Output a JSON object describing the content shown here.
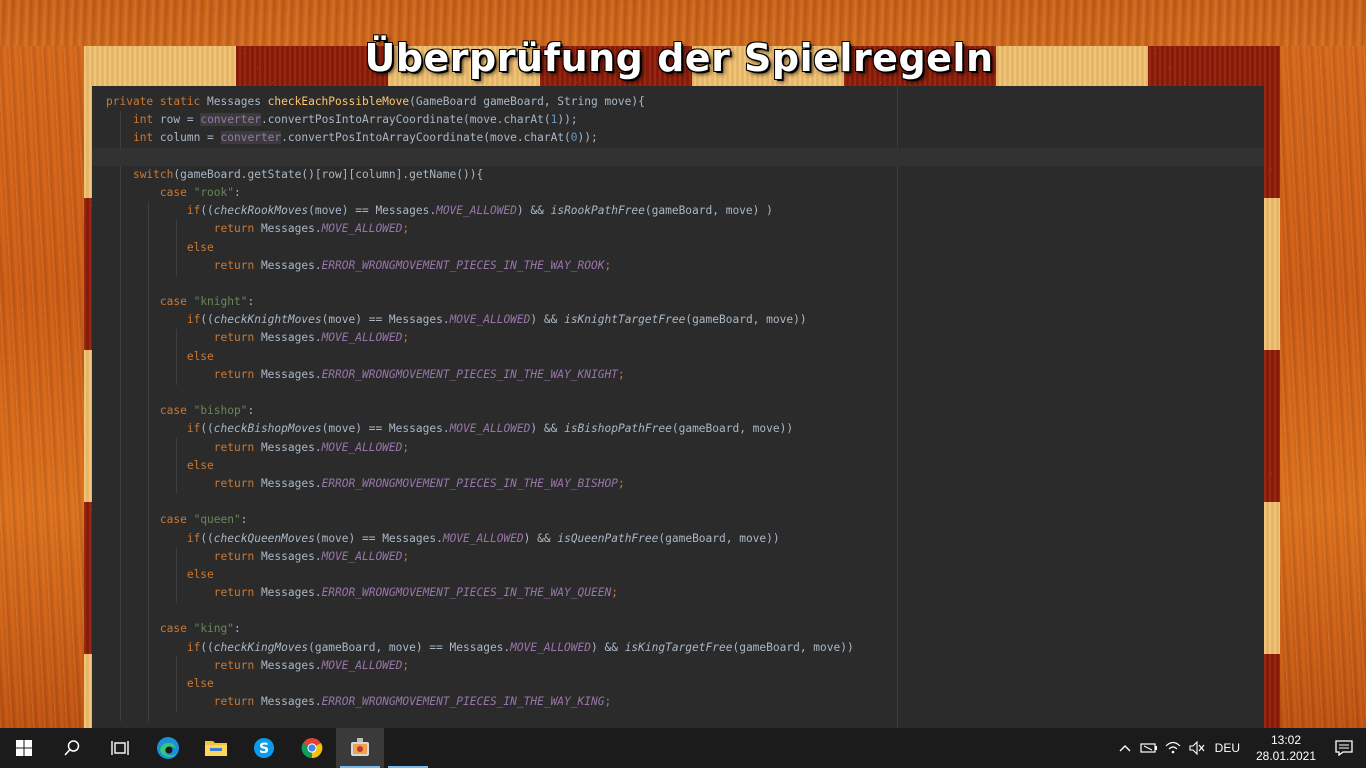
{
  "slide": {
    "title": "Überprüfung der Spielregeln"
  },
  "code": {
    "lines": [
      [
        [
          "kw",
          "private static "
        ],
        [
          "",
          "Messages "
        ],
        [
          "fn",
          "checkEachPossibleMove"
        ],
        [
          "",
          "(GameBoard gameBoard, String move){"
        ]
      ],
      [
        [
          "",
          "    "
        ],
        [
          "kw",
          "int "
        ],
        [
          "",
          "row = "
        ],
        [
          "fld",
          "converter"
        ],
        [
          "",
          ".convertPosIntoArrayCoordinate"
        ],
        [
          "",
          "(move.charAt("
        ],
        [
          "num",
          "1"
        ],
        [
          "",
          "));"
        ]
      ],
      [
        [
          "",
          "    "
        ],
        [
          "kw",
          "int "
        ],
        [
          "",
          "column = "
        ],
        [
          "fld",
          "converter"
        ],
        [
          "",
          ".convertPosIntoArrayCoordinate"
        ],
        [
          "",
          "(move.charAt("
        ],
        [
          "num",
          "0"
        ],
        [
          "",
          "));"
        ]
      ],
      [
        [
          "",
          ""
        ]
      ],
      [
        [
          "",
          "    "
        ],
        [
          "kw",
          "switch"
        ],
        [
          "",
          "(gameBoard.getState()[row][column].getName()){"
        ]
      ],
      [
        [
          "",
          "        "
        ],
        [
          "kw",
          "case "
        ],
        [
          "str",
          "\"rook\""
        ],
        [
          "",
          ":"
        ]
      ],
      [
        [
          "",
          "            "
        ],
        [
          "kw",
          "if"
        ],
        [
          "",
          "(("
        ],
        [
          "itl",
          "checkRookMoves"
        ],
        [
          "",
          "(move) == Messages."
        ],
        [
          "cst",
          "MOVE_ALLOWED"
        ],
        [
          "",
          ") && "
        ],
        [
          "itl",
          "isRookPathFree"
        ],
        [
          "",
          "(gameBoard, move) )"
        ]
      ],
      [
        [
          "",
          "                "
        ],
        [
          "kw",
          "return "
        ],
        [
          "",
          "Messages."
        ],
        [
          "cst",
          "MOVE_ALLOWED"
        ],
        [
          "kw",
          ";"
        ]
      ],
      [
        [
          "",
          "            "
        ],
        [
          "kw",
          "else"
        ]
      ],
      [
        [
          "",
          "                "
        ],
        [
          "kw",
          "return "
        ],
        [
          "",
          "Messages."
        ],
        [
          "cst",
          "ERROR_WRONGMOVEMENT_PIECES_IN_THE_WAY_ROOK"
        ],
        [
          "kw",
          ";"
        ]
      ],
      [
        [
          "",
          ""
        ]
      ],
      [
        [
          "",
          "        "
        ],
        [
          "kw",
          "case "
        ],
        [
          "str",
          "\"knight\""
        ],
        [
          "",
          ":"
        ]
      ],
      [
        [
          "",
          "            "
        ],
        [
          "kw",
          "if"
        ],
        [
          "",
          "(("
        ],
        [
          "itl",
          "checkKnightMoves"
        ],
        [
          "",
          "(move) == Messages."
        ],
        [
          "cst",
          "MOVE_ALLOWED"
        ],
        [
          "",
          ") && "
        ],
        [
          "itl",
          "isKnightTargetFree"
        ],
        [
          "",
          "(gameBoard, move))"
        ]
      ],
      [
        [
          "",
          "                "
        ],
        [
          "kw",
          "return "
        ],
        [
          "",
          "Messages."
        ],
        [
          "cst",
          "MOVE_ALLOWED"
        ],
        [
          "kw",
          ";"
        ]
      ],
      [
        [
          "",
          "            "
        ],
        [
          "kw",
          "else"
        ]
      ],
      [
        [
          "",
          "                "
        ],
        [
          "kw",
          "return "
        ],
        [
          "",
          "Messages."
        ],
        [
          "cst",
          "ERROR_WRONGMOVEMENT_PIECES_IN_THE_WAY_KNIGHT"
        ],
        [
          "kw",
          ";"
        ]
      ],
      [
        [
          "",
          ""
        ]
      ],
      [
        [
          "",
          "        "
        ],
        [
          "kw",
          "case "
        ],
        [
          "str",
          "\"bishop\""
        ],
        [
          "",
          ":"
        ]
      ],
      [
        [
          "",
          "            "
        ],
        [
          "kw",
          "if"
        ],
        [
          "",
          "(("
        ],
        [
          "itl",
          "checkBishopMoves"
        ],
        [
          "",
          "(move) == Messages."
        ],
        [
          "cst",
          "MOVE_ALLOWED"
        ],
        [
          "",
          ") && "
        ],
        [
          "itl",
          "isBishopPathFree"
        ],
        [
          "",
          "(gameBoard, move))"
        ]
      ],
      [
        [
          "",
          "                "
        ],
        [
          "kw",
          "return "
        ],
        [
          "",
          "Messages."
        ],
        [
          "cst",
          "MOVE_ALLOWED"
        ],
        [
          "kw",
          ";"
        ]
      ],
      [
        [
          "",
          "            "
        ],
        [
          "kw",
          "else"
        ]
      ],
      [
        [
          "",
          "                "
        ],
        [
          "kw",
          "return "
        ],
        [
          "",
          "Messages."
        ],
        [
          "cst",
          "ERROR_WRONGMOVEMENT_PIECES_IN_THE_WAY_BISHOP"
        ],
        [
          "kw",
          ";"
        ]
      ],
      [
        [
          "",
          ""
        ]
      ],
      [
        [
          "",
          "        "
        ],
        [
          "kw",
          "case "
        ],
        [
          "str",
          "\"queen\""
        ],
        [
          "",
          ":"
        ]
      ],
      [
        [
          "",
          "            "
        ],
        [
          "kw",
          "if"
        ],
        [
          "",
          "(("
        ],
        [
          "itl",
          "checkQueenMoves"
        ],
        [
          "",
          "(move) == Messages."
        ],
        [
          "cst",
          "MOVE_ALLOWED"
        ],
        [
          "",
          ") && "
        ],
        [
          "itl",
          "isQueenPathFree"
        ],
        [
          "",
          "(gameBoard, move))"
        ]
      ],
      [
        [
          "",
          "                "
        ],
        [
          "kw",
          "return "
        ],
        [
          "",
          "Messages."
        ],
        [
          "cst",
          "MOVE_ALLOWED"
        ],
        [
          "kw",
          ";"
        ]
      ],
      [
        [
          "",
          "            "
        ],
        [
          "kw",
          "else"
        ]
      ],
      [
        [
          "",
          "                "
        ],
        [
          "kw",
          "return "
        ],
        [
          "",
          "Messages."
        ],
        [
          "cst",
          "ERROR_WRONGMOVEMENT_PIECES_IN_THE_WAY_QUEEN"
        ],
        [
          "kw",
          ";"
        ]
      ],
      [
        [
          "",
          ""
        ]
      ],
      [
        [
          "",
          "        "
        ],
        [
          "kw",
          "case "
        ],
        [
          "str",
          "\"king\""
        ],
        [
          "",
          ":"
        ]
      ],
      [
        [
          "",
          "            "
        ],
        [
          "kw",
          "if"
        ],
        [
          "",
          "(("
        ],
        [
          "itl",
          "checkKingMoves"
        ],
        [
          "",
          "(gameBoard, move) == Messages."
        ],
        [
          "cst",
          "MOVE_ALLOWED"
        ],
        [
          "",
          ") && "
        ],
        [
          "itl",
          "isKingTargetFree"
        ],
        [
          "",
          "(gameBoard, move))"
        ]
      ],
      [
        [
          "",
          "                "
        ],
        [
          "kw",
          "return "
        ],
        [
          "",
          "Messages."
        ],
        [
          "cst",
          "MOVE_ALLOWED"
        ],
        [
          "kw",
          ";"
        ]
      ],
      [
        [
          "",
          "            "
        ],
        [
          "kw",
          "else"
        ]
      ],
      [
        [
          "",
          "                "
        ],
        [
          "kw",
          "return "
        ],
        [
          "",
          "Messages."
        ],
        [
          "cst",
          "ERROR_WRONGMOVEMENT_PIECES_IN_THE_WAY_KING"
        ],
        [
          "kw",
          ";"
        ]
      ]
    ]
  },
  "taskbar": {
    "apps": [
      {
        "name": "start-button",
        "icon": "windows-logo-icon"
      },
      {
        "name": "search-button",
        "icon": "search-icon"
      },
      {
        "name": "task-view-button",
        "icon": "task-view-icon"
      },
      {
        "name": "edge-button",
        "icon": "edge-icon"
      },
      {
        "name": "file-explorer-button",
        "icon": "folder-icon"
      },
      {
        "name": "skype-button",
        "icon": "skype-icon"
      },
      {
        "name": "chrome-button",
        "icon": "chrome-icon"
      },
      {
        "name": "presentation-app-button",
        "icon": "presentation-icon"
      }
    ],
    "language": "DEU",
    "time": "13:02",
    "date": "28.01.2021"
  },
  "colors": {
    "editor_bg": "#2b2b2b",
    "keyword": "#cc7832",
    "function": "#ffc66d",
    "string": "#6a8759",
    "constant": "#9876aa",
    "taskbar_bg": "#1b1b1b",
    "accent": "#76b9ed"
  }
}
